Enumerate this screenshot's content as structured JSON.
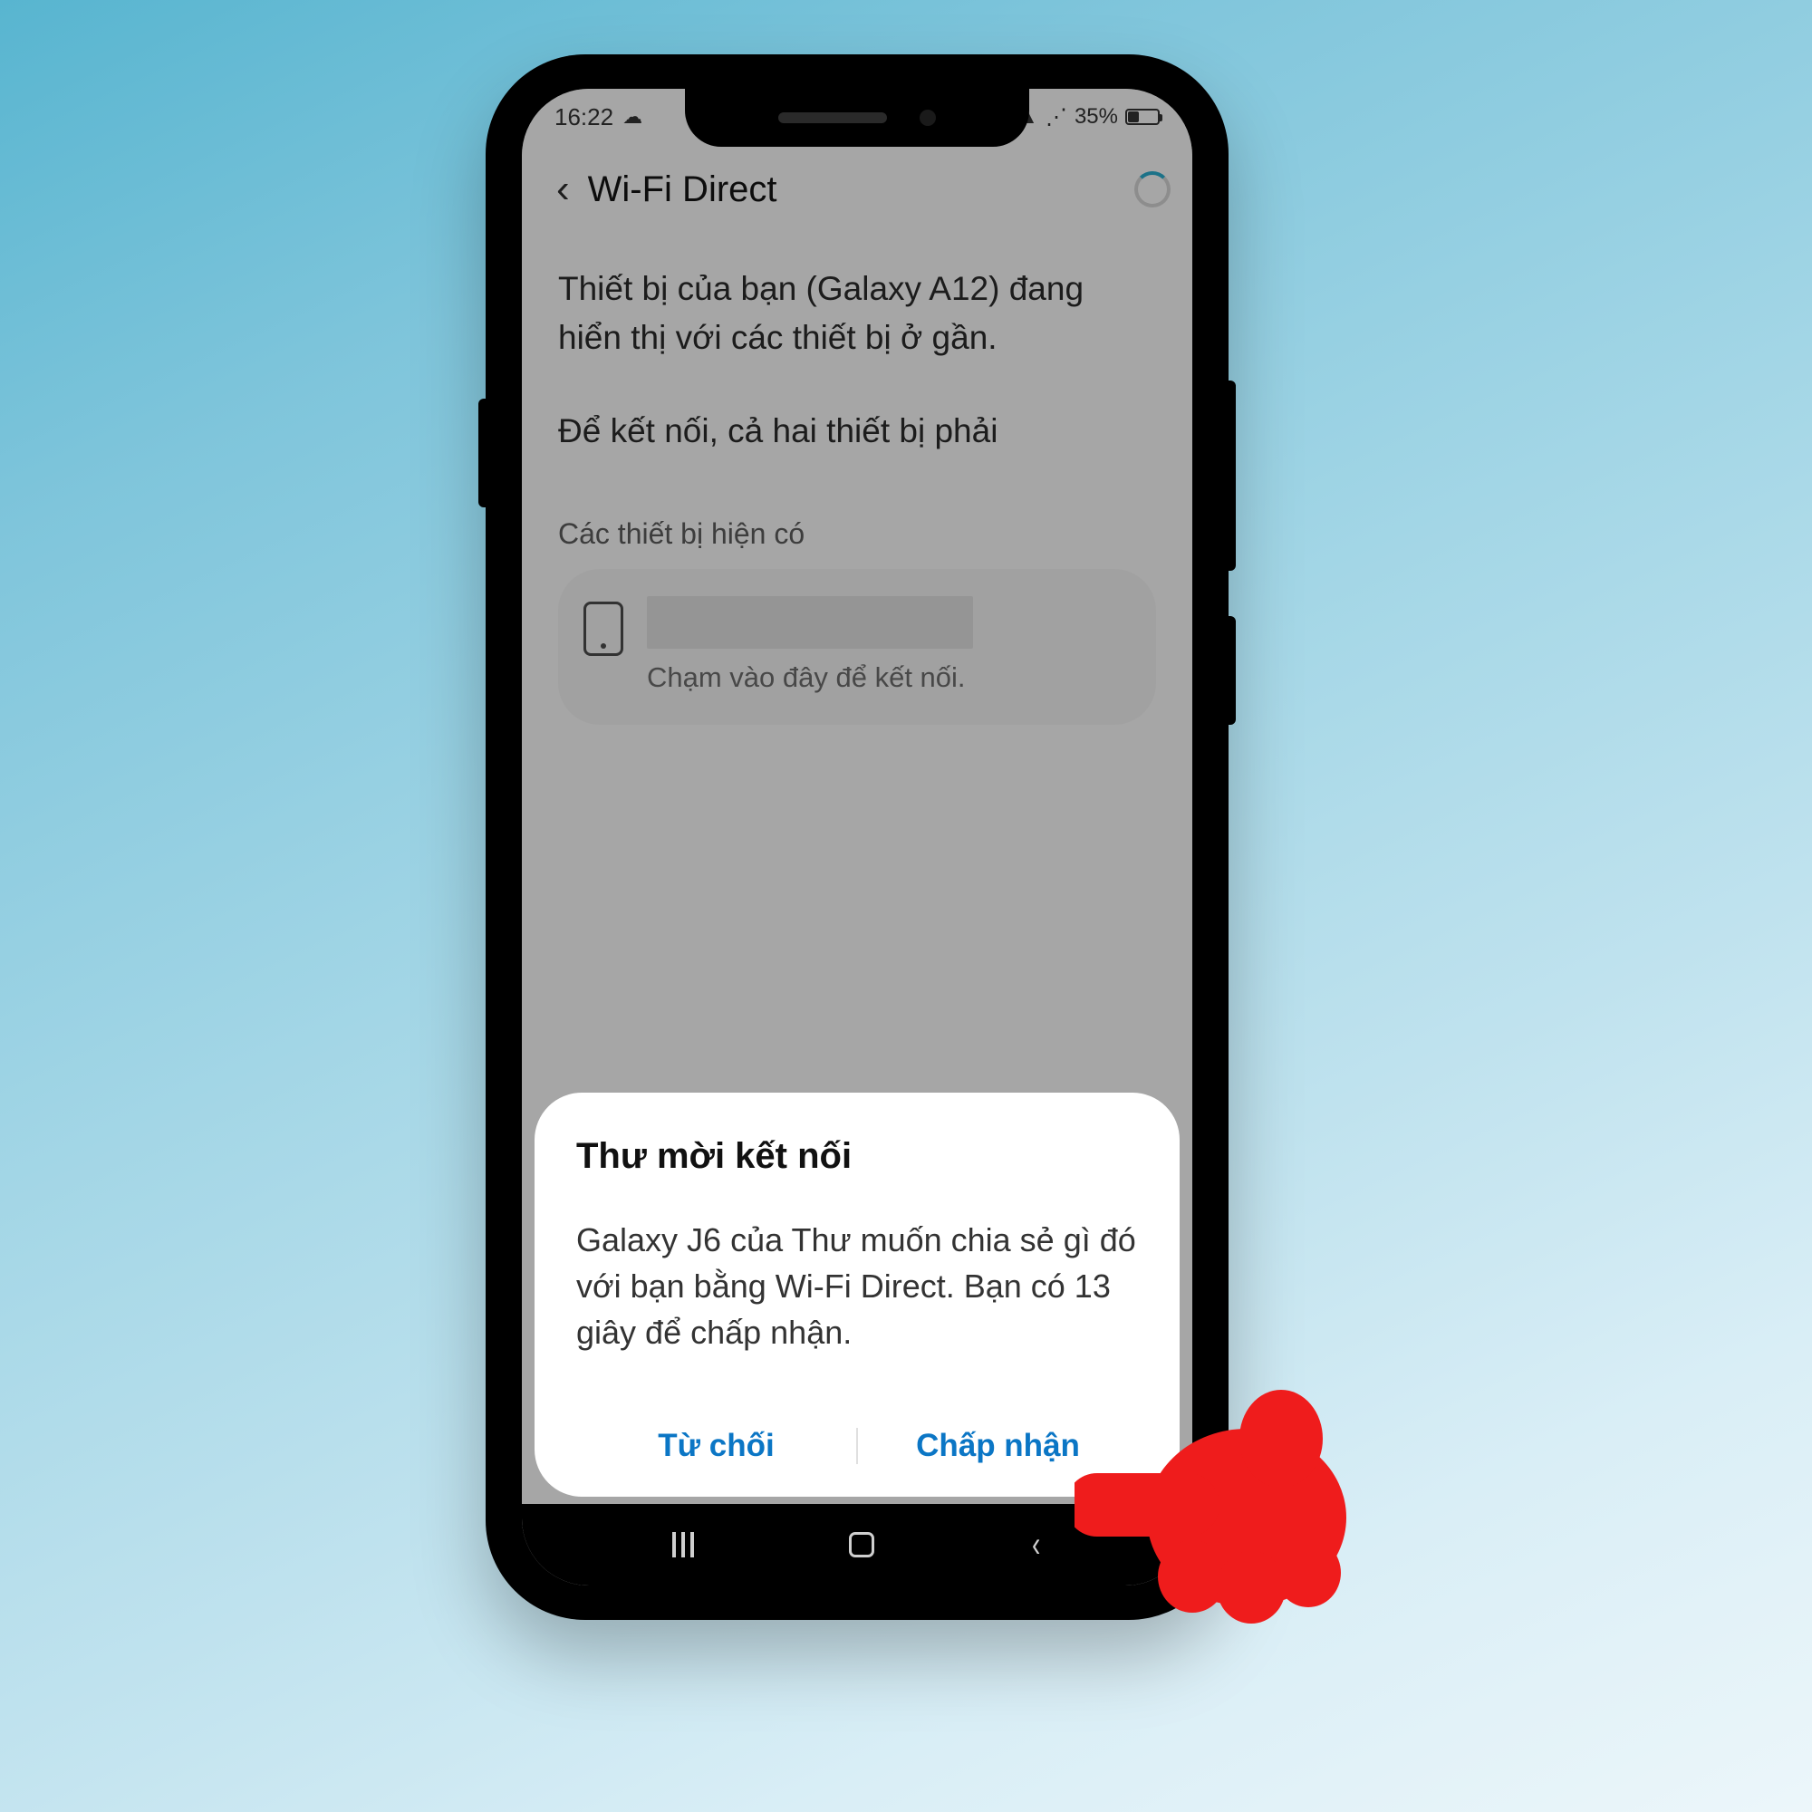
{
  "statusbar": {
    "time": "16:22",
    "signal_text": "‖ ‚",
    "battery_text": "35%"
  },
  "header": {
    "title": "Wi-Fi Direct"
  },
  "content": {
    "desc1": "Thiết bị của bạn (Galaxy A12) đang hiển thị với các thiết bị ở gần.",
    "desc2": "Để kết nối, cả hai thiết bị phải",
    "section_label": "Các thiết bị hiện có",
    "device_sub": "Chạm vào đây để kết nối."
  },
  "sheet": {
    "title": "Thư mời kết nối",
    "body": "Galaxy J6 của Thư muốn chia sẻ gì đó với bạn bằng Wi-Fi Direct. Bạn có 13 giây để chấp nhận.",
    "decline": "Từ chối",
    "accept": "Chấp nhận"
  }
}
